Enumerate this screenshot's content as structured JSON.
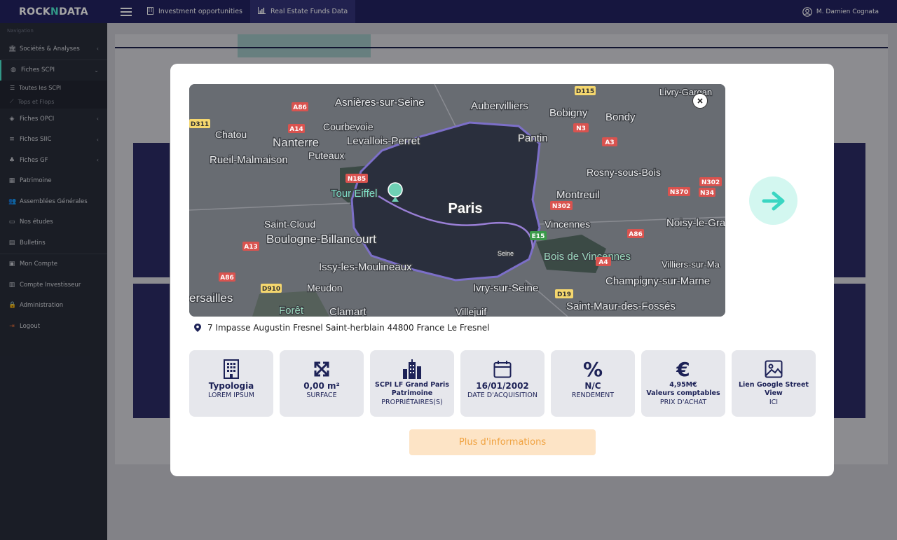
{
  "brand": {
    "name_part1": "ROCK",
    "name_sep": "N",
    "name_part2": "DATA"
  },
  "topnav": {
    "tabs": [
      {
        "label": "Investment opportunities",
        "icon": "building-icon"
      },
      {
        "label": "Real Estate Funds Data",
        "icon": "chart-icon"
      }
    ],
    "user": "M. Damien Cognata"
  },
  "sidebar": {
    "section_label": "Navigation",
    "items": [
      {
        "label": "Sociétés & Analyses",
        "icon": "bank-icon"
      },
      {
        "label": "Fiches SCPI",
        "icon": "globe-icon"
      },
      {
        "label": "Fiches OPCI",
        "icon": "layers-icon"
      },
      {
        "label": "Fiches SIIC",
        "icon": "sliders-icon"
      },
      {
        "label": "Fiches GF",
        "icon": "tree-icon"
      },
      {
        "label": "Patrimoine",
        "icon": "building-icon"
      },
      {
        "label": "Assemblées Générales",
        "icon": "users-icon"
      },
      {
        "label": "Nos études",
        "icon": "laptop-icon"
      },
      {
        "label": "Bulletins",
        "icon": "book-icon"
      },
      {
        "label": "Mon Compte",
        "icon": "id-card-icon"
      },
      {
        "label": "Compte Investisseur",
        "icon": "bar-chart-icon"
      },
      {
        "label": "Administration",
        "icon": "lock-icon"
      },
      {
        "label": "Logout",
        "icon": "logout-icon"
      }
    ],
    "sub_items": [
      {
        "label": "Toutes les SCPI",
        "icon": "list-icon"
      },
      {
        "label": "Tops et Flops",
        "icon": "line-chart-icon"
      }
    ]
  },
  "modal": {
    "map": {
      "center_label": "Paris",
      "places": [
        "Asnières-sur-Seine",
        "Aubervilliers",
        "Bobigny",
        "Bondy",
        "Livry-Gargan",
        "Chatou",
        "Courbevoie",
        "Nanterre",
        "Levallois-Perret",
        "Pantin",
        "Rueil-Malmaison",
        "Puteaux",
        "Rosny-sous-Bois",
        "Tour Eiffel",
        "Montreuil",
        "Noisy-le-Gra",
        "Saint-Cloud",
        "Boulogne-Billancourt",
        "Vincennes",
        "Bois de Vincennes",
        "Issy-les-Moulineaux",
        "Villiers-sur-Ma",
        "Meudon",
        "Ivry-sur-Seine",
        "Champigny-sur-Marne",
        "ersailles",
        "Forêt",
        "Clamart",
        "Villejuif",
        "Saint-Maur-des-Fossés",
        "Seine"
      ],
      "roads": [
        "D115",
        "A86",
        "D311",
        "A14",
        "N3",
        "A3",
        "N185",
        "N302",
        "N370",
        "N34",
        "N302",
        "E15",
        "A13",
        "A86",
        "A4",
        "A86",
        "D910",
        "D19"
      ]
    },
    "address": "7 Impasse Augustin Fresnel Saint-herblain 44800 France Le Fresnel",
    "tiles": [
      {
        "icon": "building-icon",
        "value": "Typologia",
        "label": "LOREM IPSUM"
      },
      {
        "icon": "expand-icon",
        "value": "0,00 m²",
        "label": "SURFACE"
      },
      {
        "icon": "city-icon",
        "value": "SCPI LF Grand Paris Patrimoine",
        "label": "PROPRIÉTAIRES(S)"
      },
      {
        "icon": "calendar-icon",
        "value": "16/01/2002",
        "label": "DATE D'ACQUISITION"
      },
      {
        "icon": "percent-icon",
        "value": "N/C",
        "label": "RENDEMENT"
      },
      {
        "icon": "euro-icon",
        "value": "4,95M€",
        "value2": "Valeurs comptables",
        "label": "PRIX D'ACHAT"
      },
      {
        "icon": "image-icon",
        "value": "Lien Google Street View",
        "label": "ICI"
      }
    ],
    "more_button": "Plus d'informations"
  }
}
